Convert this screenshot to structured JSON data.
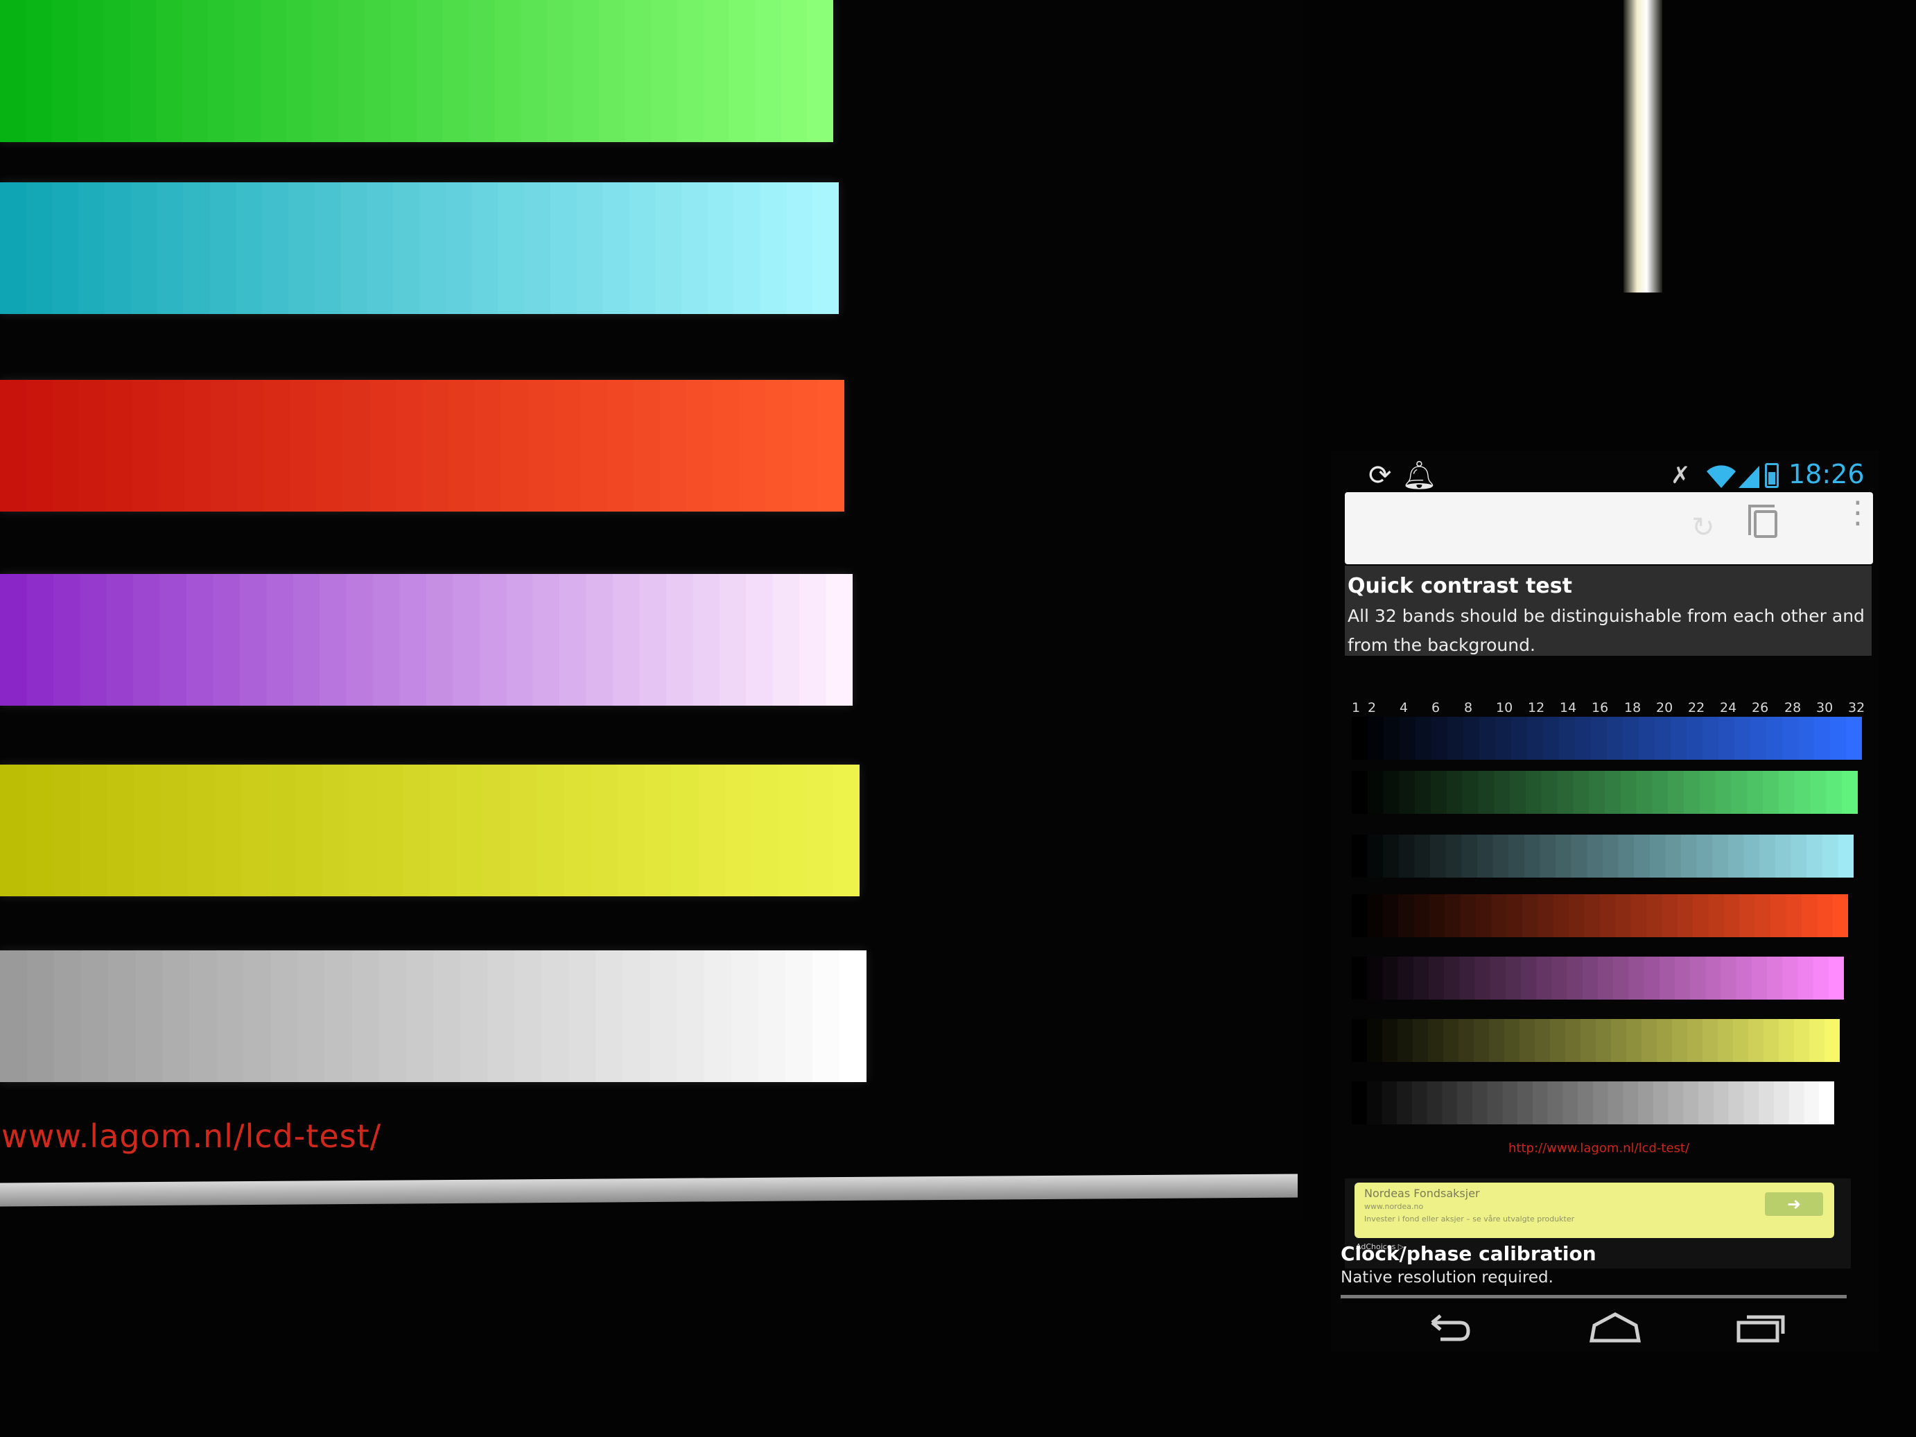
{
  "monitor": {
    "url": "www.lagom.nl/lcd-test/",
    "bars": [
      {
        "name": "green",
        "from": "#06b313",
        "to": "#8bff77"
      },
      {
        "name": "cyan",
        "from": "#0fa5b4",
        "to": "#a9f6ff"
      },
      {
        "name": "red",
        "from": "#c7130b",
        "to": "#ff5a2c"
      },
      {
        "name": "purple",
        "from": "#8a26c8",
        "to": "#fff1ff"
      },
      {
        "name": "yellow",
        "from": "#bcbd05",
        "to": "#eef34c"
      },
      {
        "name": "white",
        "from": "#9a9a9a",
        "to": "#ffffff"
      }
    ]
  },
  "phone": {
    "status_bar": {
      "time": "18:26",
      "icons": [
        "sync-icon",
        "notification-bell-icon",
        "mute-icon",
        "wifi-icon",
        "signal-icon",
        "battery-icon"
      ],
      "accent": "#35b6ec"
    },
    "browser": {
      "icons": [
        "reload-icon",
        "tabs-icon",
        "overflow-menu-icon"
      ]
    },
    "quick_test": {
      "title": "Quick contrast test",
      "description": "All 32 bands should be distinguishable from each other and from the background."
    },
    "band_numbers": [
      "1",
      "2",
      "4",
      "6",
      "8",
      "10",
      "12",
      "14",
      "16",
      "18",
      "20",
      "22",
      "24",
      "26",
      "28",
      "30",
      "32"
    ],
    "bands": [
      {
        "name": "blue",
        "from": "#000000",
        "to": "#2f6cff"
      },
      {
        "name": "green",
        "from": "#000000",
        "to": "#61f27e"
      },
      {
        "name": "cyan",
        "from": "#000000",
        "to": "#9fe9f4"
      },
      {
        "name": "red",
        "from": "#000000",
        "to": "#ff4e22"
      },
      {
        "name": "purple",
        "from": "#000000",
        "to": "#ff8bff"
      },
      {
        "name": "yellow",
        "from": "#000000",
        "to": "#f6f86a"
      },
      {
        "name": "white",
        "from": "#000000",
        "to": "#ffffff"
      }
    ],
    "page_url": "http://www.lagom.nl/lcd-test/",
    "ad": {
      "title": "Nordeas Fondsaksjer",
      "subtitle": "www.nordea.no",
      "description": "Invester i fond eller aksjer – se våre utvalgte produkter",
      "choices_label": "AdChoices ▷",
      "button_glyph": "➜"
    },
    "clock_section": {
      "title": "Clock/phase calibration",
      "text": "Native resolution required."
    },
    "nav_icons": [
      "back-icon",
      "home-icon",
      "recent-apps-icon"
    ]
  }
}
